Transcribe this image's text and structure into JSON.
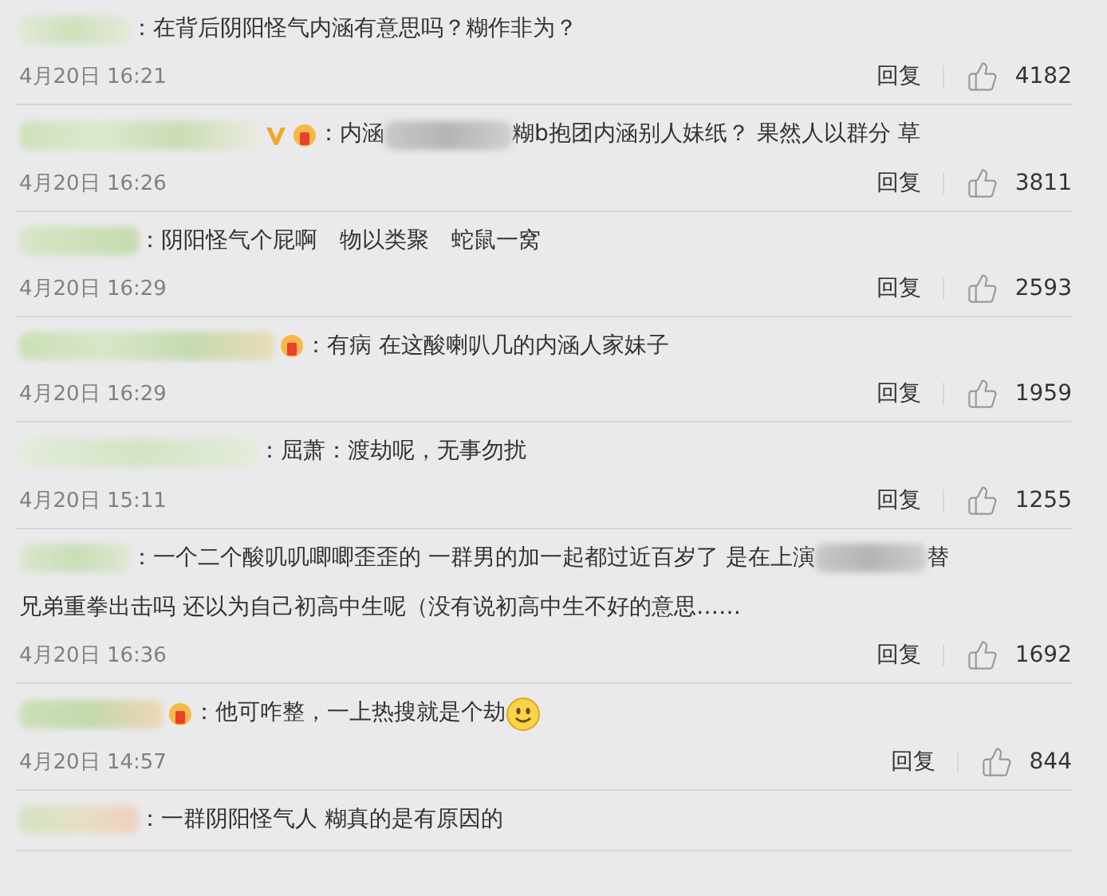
{
  "comments": [
    {
      "content": [
        {
          "kind": "text",
          "text": "：在背后阴阳怪气内涵有意思吗？糊作非为？"
        }
      ],
      "date": "4月20日 16:21",
      "reply": "回复",
      "likes": "4182"
    },
    {
      "badges": [
        {
          "kind": "verified"
        },
        {
          "kind": "medal"
        }
      ],
      "content": [
        {
          "kind": "text",
          "text": "：内涵"
        },
        {
          "kind": "blur"
        },
        {
          "kind": "text",
          "text": "糊b抱团内涵别人妹纸？ 果然人以群分 草"
        }
      ],
      "date": "4月20日 16:26",
      "reply": "回复",
      "likes": "3811"
    },
    {
      "content": [
        {
          "kind": "text",
          "text": "：阴阳怪气个屁啊　物以类聚　蛇鼠一窝"
        }
      ],
      "date": "4月20日 16:29",
      "reply": "回复",
      "likes": "2593"
    },
    {
      "badges": [
        {
          "kind": "medal"
        }
      ],
      "content": [
        {
          "kind": "text",
          "text": "：有病 在这酸喇叭几的内涵人家妹子"
        }
      ],
      "date": "4月20日 16:29",
      "reply": "回复",
      "likes": "1959"
    },
    {
      "content": [
        {
          "kind": "text",
          "text": "：屈萧：渡劫呢，无事勿扰"
        }
      ],
      "date": "4月20日 15:11",
      "reply": "回复",
      "likes": "1255"
    },
    {
      "content": [
        {
          "kind": "text",
          "text": "：一个二个酸叽叽唧唧歪歪的 一群男的加一起都过近百岁了 是在上演"
        },
        {
          "kind": "blur"
        },
        {
          "kind": "text",
          "text": "替"
        },
        {
          "kind": "line",
          "text": "兄弟重拳出击吗 还以为自己初高中生呢（没有说初高中生不好的意思……"
        }
      ],
      "date": "4月20日 16:36",
      "reply": "回复",
      "likes": "1692"
    },
    {
      "badges": [
        {
          "kind": "medal"
        }
      ],
      "content": [
        {
          "kind": "text",
          "text": "：他可咋整，一上热搜就是个劫"
        },
        {
          "kind": "emoji"
        }
      ],
      "date": "4月20日 14:57",
      "reply": "回复",
      "likes": "844"
    },
    {
      "content": [
        {
          "kind": "text",
          "text": "：一群阴阳怪气人 糊真的是有原因的"
        }
      ]
    }
  ]
}
